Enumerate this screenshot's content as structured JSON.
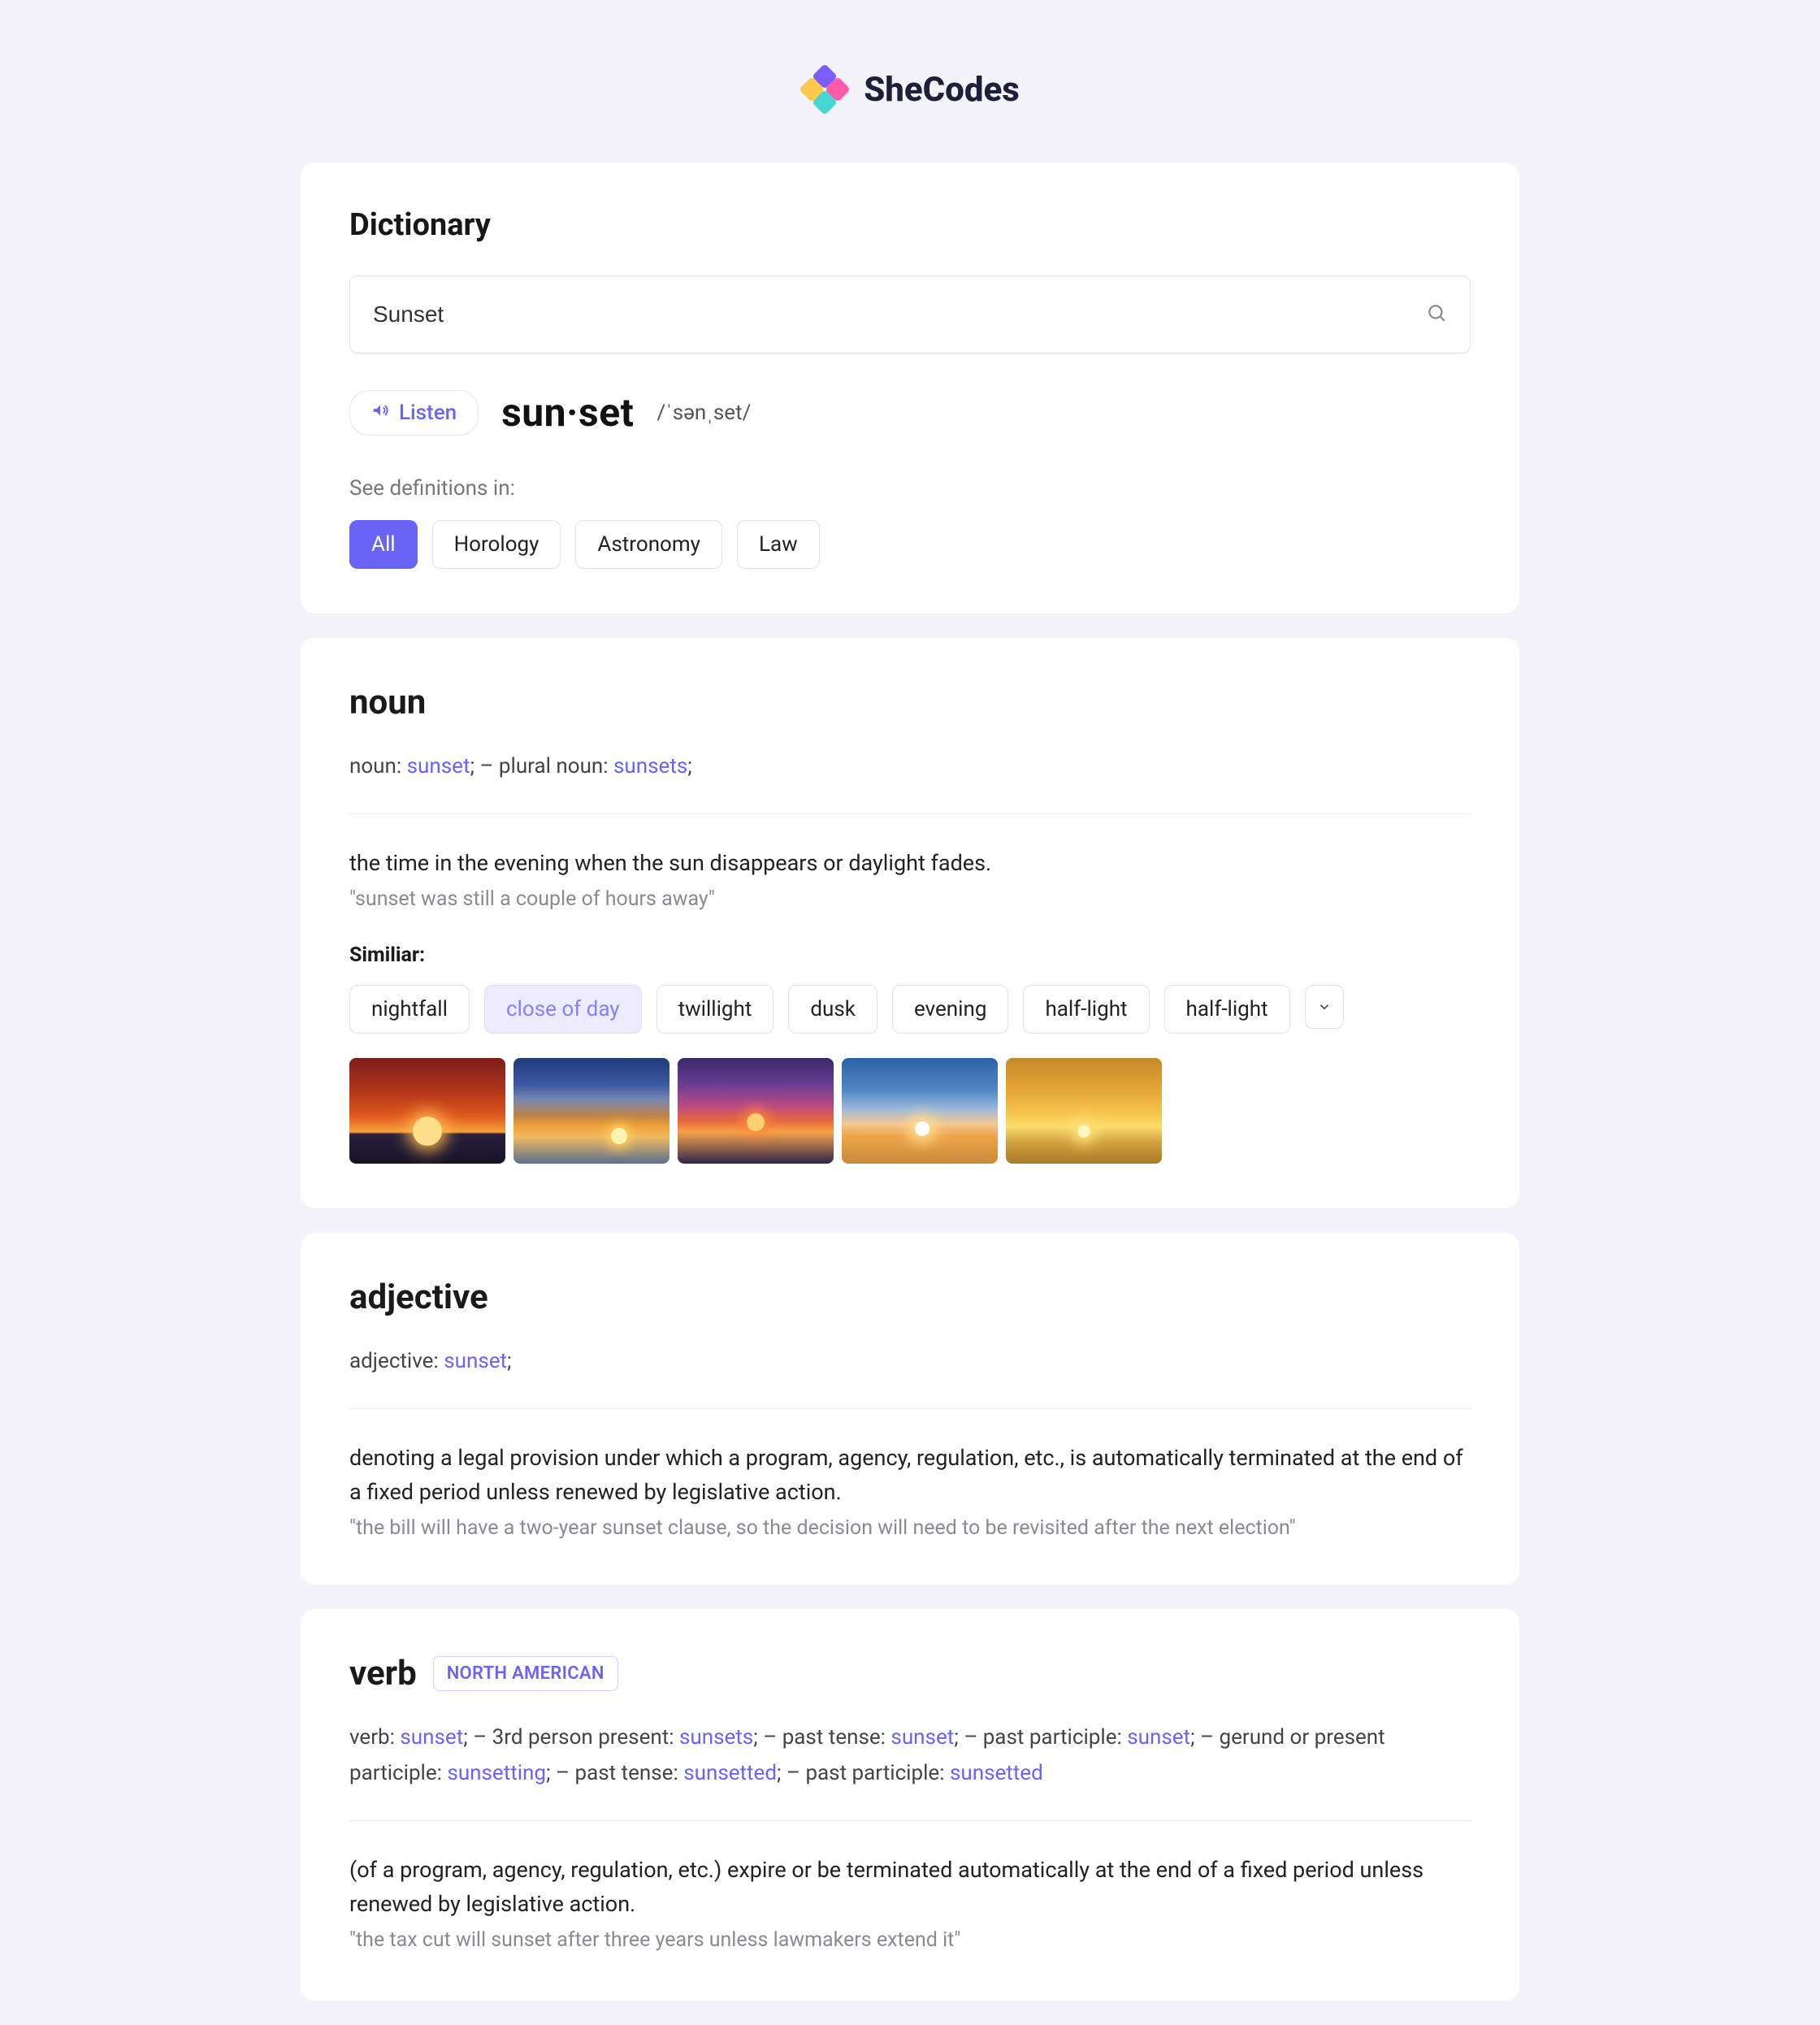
{
  "brand": {
    "name": "SheCodes"
  },
  "header": {
    "title": "Dictionary",
    "search_value": "Sunset",
    "listen_label": "Listen",
    "hyphenation": "sun·set",
    "phonetic": "/ˈsənˌset/",
    "defs_in_label": "See definitions in:",
    "categories": [
      "All",
      "Horology",
      "Astronomy",
      "Law"
    ],
    "active_category": "All"
  },
  "noun": {
    "title": "noun",
    "forms_prefix1": "noun: ",
    "forms_word1": "sunset",
    "forms_sep": ";   –   plural noun: ",
    "forms_word2": "sunsets",
    "forms_end": ";",
    "definition": "the time in the evening when the sun disappears or daylight fades.",
    "example": "\"sunset was still a couple of hours away\"",
    "similar_label": "Similiar:",
    "similar": [
      "nightfall",
      "close of day",
      "twillight",
      "dusk",
      "evening",
      "half-light",
      "half-light"
    ],
    "similar_soft_index": 1
  },
  "adjective": {
    "title": "adjective",
    "forms_prefix": "adjective: ",
    "forms_word": "sunset",
    "forms_end": ";",
    "definition": "denoting a legal provision under which a program, agency, regulation, etc., is automatically terminated at the end of a fixed period unless renewed by legislative action.",
    "example": "\"the bill will have a two-year sunset clause, so the decision will need to be revisited after the next election\""
  },
  "verb": {
    "title": "verb",
    "region": "NORTH AMERICAN",
    "forms_parts": [
      {
        "t": "verb: "
      },
      {
        "k": "sunset"
      },
      {
        "t": ";   –   3rd person present: "
      },
      {
        "k": "sunsets"
      },
      {
        "t": ";   –   past tense: "
      },
      {
        "k": "sunset"
      },
      {
        "t": ";   –   past participle: "
      },
      {
        "k": "sunset"
      },
      {
        "t": ";   –   gerund or present participle: "
      },
      {
        "k": "sunsetting"
      },
      {
        "t": ";   –   past tense: "
      },
      {
        "k": "sunsetted"
      },
      {
        "t": ";   –   past participle: "
      },
      {
        "k": "sunsetted"
      }
    ],
    "definition": "(of a program, agency, regulation, etc.) expire or be terminated automatically at the end of a fixed period unless renewed by legislative action.",
    "example": "\"the tax cut will sunset after three years unless lawmakers extend it\""
  }
}
